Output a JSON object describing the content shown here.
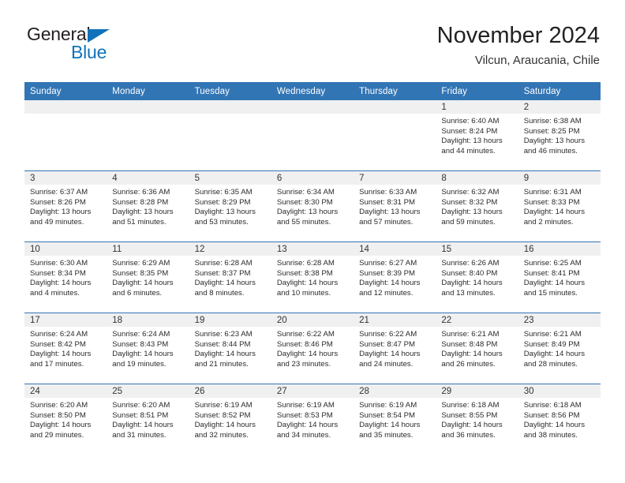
{
  "logo": {
    "text_top": "General",
    "text_bottom": "Blue",
    "triangle_color": "#1172ba",
    "top_color": "#231f20"
  },
  "header": {
    "title": "November 2024",
    "location": "Vilcun, Araucania, Chile"
  },
  "theme": {
    "header_blue": "#3275b5",
    "daynum_strip": "#f0f0f0",
    "text": "#2b2b2b"
  },
  "weekdays": [
    "Sunday",
    "Monday",
    "Tuesday",
    "Wednesday",
    "Thursday",
    "Friday",
    "Saturday"
  ],
  "weeks": [
    [
      {
        "day": "",
        "empty": true
      },
      {
        "day": "",
        "empty": true
      },
      {
        "day": "",
        "empty": true
      },
      {
        "day": "",
        "empty": true
      },
      {
        "day": "",
        "empty": true
      },
      {
        "day": "1",
        "sunrise": "Sunrise: 6:40 AM",
        "sunset": "Sunset: 8:24 PM",
        "daylight": "Daylight: 13 hours and 44 minutes."
      },
      {
        "day": "2",
        "sunrise": "Sunrise: 6:38 AM",
        "sunset": "Sunset: 8:25 PM",
        "daylight": "Daylight: 13 hours and 46 minutes."
      }
    ],
    [
      {
        "day": "3",
        "sunrise": "Sunrise: 6:37 AM",
        "sunset": "Sunset: 8:26 PM",
        "daylight": "Daylight: 13 hours and 49 minutes."
      },
      {
        "day": "4",
        "sunrise": "Sunrise: 6:36 AM",
        "sunset": "Sunset: 8:28 PM",
        "daylight": "Daylight: 13 hours and 51 minutes."
      },
      {
        "day": "5",
        "sunrise": "Sunrise: 6:35 AM",
        "sunset": "Sunset: 8:29 PM",
        "daylight": "Daylight: 13 hours and 53 minutes."
      },
      {
        "day": "6",
        "sunrise": "Sunrise: 6:34 AM",
        "sunset": "Sunset: 8:30 PM",
        "daylight": "Daylight: 13 hours and 55 minutes."
      },
      {
        "day": "7",
        "sunrise": "Sunrise: 6:33 AM",
        "sunset": "Sunset: 8:31 PM",
        "daylight": "Daylight: 13 hours and 57 minutes."
      },
      {
        "day": "8",
        "sunrise": "Sunrise: 6:32 AM",
        "sunset": "Sunset: 8:32 PM",
        "daylight": "Daylight: 13 hours and 59 minutes."
      },
      {
        "day": "9",
        "sunrise": "Sunrise: 6:31 AM",
        "sunset": "Sunset: 8:33 PM",
        "daylight": "Daylight: 14 hours and 2 minutes."
      }
    ],
    [
      {
        "day": "10",
        "sunrise": "Sunrise: 6:30 AM",
        "sunset": "Sunset: 8:34 PM",
        "daylight": "Daylight: 14 hours and 4 minutes."
      },
      {
        "day": "11",
        "sunrise": "Sunrise: 6:29 AM",
        "sunset": "Sunset: 8:35 PM",
        "daylight": "Daylight: 14 hours and 6 minutes."
      },
      {
        "day": "12",
        "sunrise": "Sunrise: 6:28 AM",
        "sunset": "Sunset: 8:37 PM",
        "daylight": "Daylight: 14 hours and 8 minutes."
      },
      {
        "day": "13",
        "sunrise": "Sunrise: 6:28 AM",
        "sunset": "Sunset: 8:38 PM",
        "daylight": "Daylight: 14 hours and 10 minutes."
      },
      {
        "day": "14",
        "sunrise": "Sunrise: 6:27 AM",
        "sunset": "Sunset: 8:39 PM",
        "daylight": "Daylight: 14 hours and 12 minutes."
      },
      {
        "day": "15",
        "sunrise": "Sunrise: 6:26 AM",
        "sunset": "Sunset: 8:40 PM",
        "daylight": "Daylight: 14 hours and 13 minutes."
      },
      {
        "day": "16",
        "sunrise": "Sunrise: 6:25 AM",
        "sunset": "Sunset: 8:41 PM",
        "daylight": "Daylight: 14 hours and 15 minutes."
      }
    ],
    [
      {
        "day": "17",
        "sunrise": "Sunrise: 6:24 AM",
        "sunset": "Sunset: 8:42 PM",
        "daylight": "Daylight: 14 hours and 17 minutes."
      },
      {
        "day": "18",
        "sunrise": "Sunrise: 6:24 AM",
        "sunset": "Sunset: 8:43 PM",
        "daylight": "Daylight: 14 hours and 19 minutes."
      },
      {
        "day": "19",
        "sunrise": "Sunrise: 6:23 AM",
        "sunset": "Sunset: 8:44 PM",
        "daylight": "Daylight: 14 hours and 21 minutes."
      },
      {
        "day": "20",
        "sunrise": "Sunrise: 6:22 AM",
        "sunset": "Sunset: 8:46 PM",
        "daylight": "Daylight: 14 hours and 23 minutes."
      },
      {
        "day": "21",
        "sunrise": "Sunrise: 6:22 AM",
        "sunset": "Sunset: 8:47 PM",
        "daylight": "Daylight: 14 hours and 24 minutes."
      },
      {
        "day": "22",
        "sunrise": "Sunrise: 6:21 AM",
        "sunset": "Sunset: 8:48 PM",
        "daylight": "Daylight: 14 hours and 26 minutes."
      },
      {
        "day": "23",
        "sunrise": "Sunrise: 6:21 AM",
        "sunset": "Sunset: 8:49 PM",
        "daylight": "Daylight: 14 hours and 28 minutes."
      }
    ],
    [
      {
        "day": "24",
        "sunrise": "Sunrise: 6:20 AM",
        "sunset": "Sunset: 8:50 PM",
        "daylight": "Daylight: 14 hours and 29 minutes."
      },
      {
        "day": "25",
        "sunrise": "Sunrise: 6:20 AM",
        "sunset": "Sunset: 8:51 PM",
        "daylight": "Daylight: 14 hours and 31 minutes."
      },
      {
        "day": "26",
        "sunrise": "Sunrise: 6:19 AM",
        "sunset": "Sunset: 8:52 PM",
        "daylight": "Daylight: 14 hours and 32 minutes."
      },
      {
        "day": "27",
        "sunrise": "Sunrise: 6:19 AM",
        "sunset": "Sunset: 8:53 PM",
        "daylight": "Daylight: 14 hours and 34 minutes."
      },
      {
        "day": "28",
        "sunrise": "Sunrise: 6:19 AM",
        "sunset": "Sunset: 8:54 PM",
        "daylight": "Daylight: 14 hours and 35 minutes."
      },
      {
        "day": "29",
        "sunrise": "Sunrise: 6:18 AM",
        "sunset": "Sunset: 8:55 PM",
        "daylight": "Daylight: 14 hours and 36 minutes."
      },
      {
        "day": "30",
        "sunrise": "Sunrise: 6:18 AM",
        "sunset": "Sunset: 8:56 PM",
        "daylight": "Daylight: 14 hours and 38 minutes."
      }
    ]
  ]
}
